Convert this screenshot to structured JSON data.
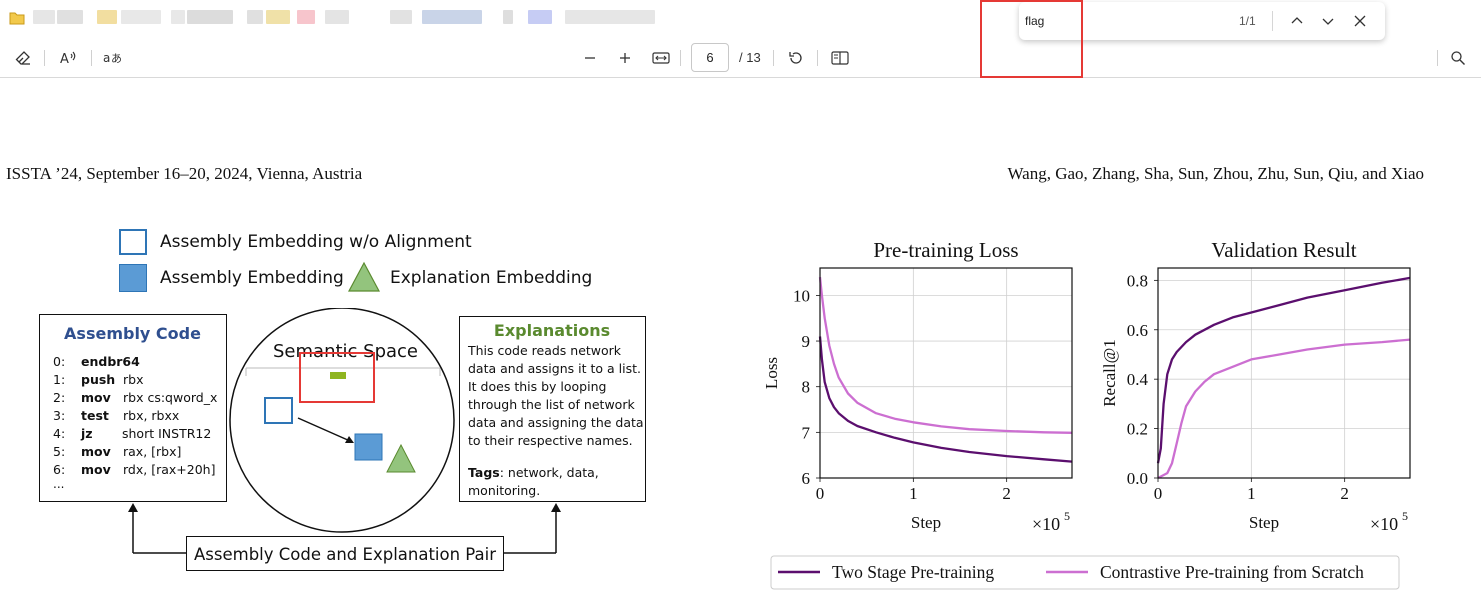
{
  "browser": {
    "tab_colors": [
      "#e6e6e6",
      "#e0e0e0",
      "#f2dea0",
      "#e8e8e8",
      "#e8e8e8",
      "#dcdcdc",
      "#e0e0e0",
      "#f0e1a8",
      "#f7c5cc",
      "#e4e4e4",
      "#e2e2e2",
      "#c9d4e8",
      "#dedede",
      "#c6ccf4",
      "#e6e6e6"
    ],
    "folder_color": "#f2c94c"
  },
  "toolbar": {
    "icons": [
      "eraser-icon",
      "read-aloud-icon",
      "translate-icon",
      "zoom-out-icon",
      "zoom-in-icon",
      "fit-width-icon",
      "rotate-icon",
      "two-page-icon",
      "search-icon"
    ],
    "page_current": "6",
    "page_total": "/ 13"
  },
  "findbar": {
    "query": "flag",
    "count": "1/1"
  },
  "document": {
    "header_left": "ISSTA ’24, September 16–20, 2024, Vienna, Austria",
    "header_right": "Wang, Gao, Zhang, Sha, Sun, Zhou, Zhu, Sun, Qiu, and Xiao"
  },
  "figure_left": {
    "legend": {
      "item1": "Assembly Embedding w/o Alignment",
      "item2": "Assembly Embedding",
      "item3": "Explanation Embedding"
    },
    "code_box": {
      "title": "Assembly Code",
      "lines": [
        {
          "n": "0:",
          "op": "endbr64",
          "args": ""
        },
        {
          "n": "1:",
          "op": "push",
          "args": "rbx"
        },
        {
          "n": "2:",
          "op": "mov",
          "args": "rbx  cs:qword_x"
        },
        {
          "n": "3:",
          "op": "test",
          "args": "rbx, rbxx"
        },
        {
          "n": "4:",
          "op": "jz",
          "args": "short INSTR12"
        },
        {
          "n": "5:",
          "op": "mov",
          "args": "rax, [rbx]"
        },
        {
          "n": "6:",
          "op": "mov",
          "args": "rdx, [rax+20h]"
        }
      ],
      "ellipsis": "..."
    },
    "semantic_space_label": "Semantic Space",
    "explanations": {
      "title": "Explanations",
      "lines": [
        "This code reads network",
        "data and assigns it to a list.",
        "It does this by looping",
        "through the list of network",
        "data and assigning the data",
        "to their respective names."
      ],
      "tags_label": "Tags",
      "tags_value": ": network, data,",
      "tags_value2": "monitoring."
    },
    "pair_label": "Assembly Code and Explanation Pair",
    "colors": {
      "code_title": "#2f4f8f",
      "explain_title": "#5a8a2f",
      "square_blue": "#5b9bd5",
      "square_border": "#2e75b6",
      "triangle": "#93c47d",
      "highlight": "#e53935",
      "green_mark": "#8fb520"
    }
  },
  "chart_data": [
    {
      "type": "line",
      "title": "Pre-training Loss",
      "xlabel": "Step",
      "ylabel": "Loss",
      "x_multiplier": "×10",
      "x_exponent": "5",
      "xlim": [
        0,
        2.7
      ],
      "ylim": [
        6,
        10.6
      ],
      "xticks": [
        "0",
        "1",
        "2"
      ],
      "yticks": [
        "6",
        "7",
        "8",
        "9",
        "10"
      ],
      "grid": true,
      "series": [
        {
          "name": "Two Stage Pre-training",
          "color": "#5b0f6e",
          "x": [
            0,
            0.02,
            0.05,
            0.1,
            0.15,
            0.2,
            0.3,
            0.4,
            0.6,
            0.8,
            1.0,
            1.3,
            1.6,
            2.0,
            2.4,
            2.7
          ],
          "y": [
            9.1,
            8.6,
            8.1,
            7.75,
            7.55,
            7.42,
            7.25,
            7.14,
            7.0,
            6.88,
            6.78,
            6.66,
            6.57,
            6.48,
            6.41,
            6.36
          ]
        },
        {
          "name": "Contrastive Pre-training from Scratch",
          "color": "#cc6fd1",
          "x": [
            0,
            0.02,
            0.05,
            0.1,
            0.15,
            0.2,
            0.3,
            0.4,
            0.6,
            0.8,
            1.0,
            1.3,
            1.6,
            2.0,
            2.4,
            2.7
          ],
          "y": [
            10.4,
            10.0,
            9.5,
            8.9,
            8.5,
            8.2,
            7.85,
            7.65,
            7.42,
            7.3,
            7.22,
            7.13,
            7.07,
            7.03,
            7.0,
            6.99
          ]
        }
      ]
    },
    {
      "type": "line",
      "title": "Validation Result",
      "xlabel": "Step",
      "ylabel": "Recall@1",
      "x_multiplier": "×10",
      "x_exponent": "5",
      "xlim": [
        0,
        2.7
      ],
      "ylim": [
        0,
        0.85
      ],
      "xticks": [
        "0",
        "1",
        "2"
      ],
      "yticks": [
        "0.0",
        "0.2",
        "0.4",
        "0.6",
        "0.8"
      ],
      "grid": true,
      "series": [
        {
          "name": "Two Stage Pre-training",
          "color": "#5b0f6e",
          "x": [
            0,
            0.03,
            0.06,
            0.1,
            0.15,
            0.2,
            0.3,
            0.4,
            0.6,
            0.8,
            1.0,
            1.3,
            1.6,
            2.0,
            2.4,
            2.7
          ],
          "y": [
            0.06,
            0.12,
            0.3,
            0.42,
            0.48,
            0.51,
            0.55,
            0.58,
            0.62,
            0.65,
            0.67,
            0.7,
            0.73,
            0.76,
            0.79,
            0.81
          ]
        },
        {
          "name": "Contrastive Pre-training from Scratch",
          "color": "#cc6fd1",
          "x": [
            0,
            0.1,
            0.15,
            0.2,
            0.25,
            0.3,
            0.4,
            0.5,
            0.6,
            0.8,
            1.0,
            1.3,
            1.6,
            2.0,
            2.4,
            2.7
          ],
          "y": [
            0.0,
            0.02,
            0.06,
            0.14,
            0.22,
            0.29,
            0.35,
            0.39,
            0.42,
            0.45,
            0.48,
            0.5,
            0.52,
            0.54,
            0.55,
            0.56
          ]
        }
      ]
    }
  ],
  "chart_legend": [
    "Two Stage Pre-training",
    "Contrastive Pre-training from Scratch"
  ]
}
